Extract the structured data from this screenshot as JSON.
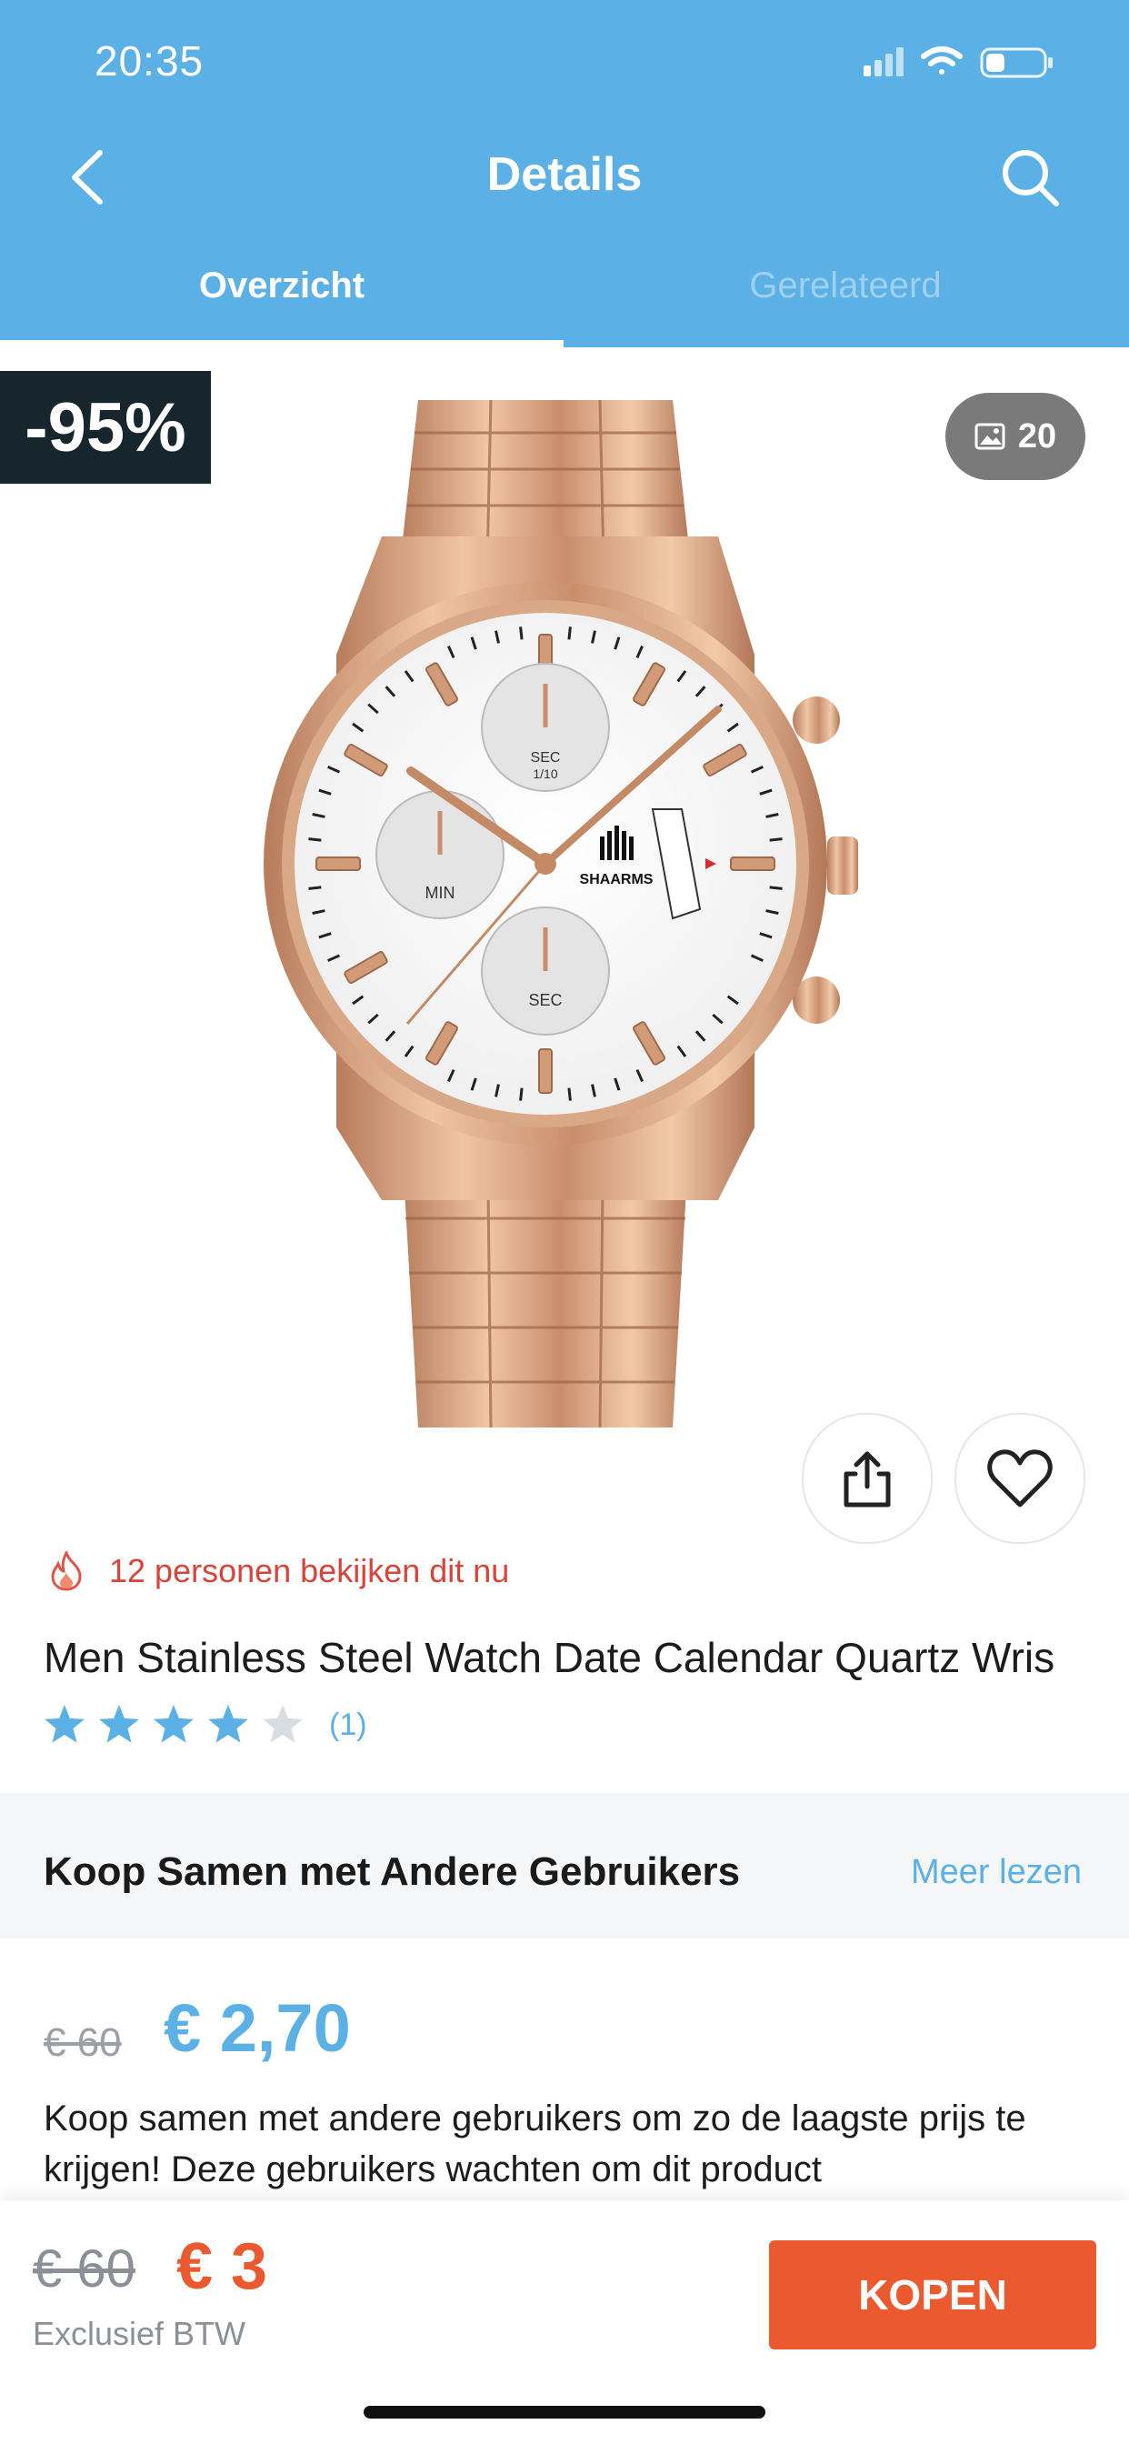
{
  "status_bar": {
    "time": "20:35"
  },
  "header": {
    "title": "Details"
  },
  "tabs": [
    {
      "label": "Overzicht"
    },
    {
      "label": "Gerelateerd"
    }
  ],
  "gallery": {
    "discount_badge": "-95%",
    "image_count": "20"
  },
  "watch_text": {
    "brand": "SHAARMS",
    "sub_top": "SEC",
    "sub_top_2": "1/10",
    "sub_left": "MIN",
    "sub_bottom": "SEC"
  },
  "viewers": {
    "text": "12 personen bekijken dit nu"
  },
  "product": {
    "title": "Men Stainless Steel Watch Date Calendar Quartz Wris",
    "rating": 4,
    "rating_count": "(1)"
  },
  "section": {
    "title": "Koop Samen met Andere Gebruikers",
    "link": "Meer lezen"
  },
  "group_price": {
    "old": "€ 60",
    "new": "€ 2,70"
  },
  "description": "Koop samen met andere gebruikers om zo de laagste prijs te krijgen! Deze gebruikers wachten om dit product",
  "bottom_bar": {
    "old_price": "€ 60",
    "new_price": "€ 3",
    "note": "Exclusief BTW",
    "buy_label": "KOPEN"
  },
  "colors": {
    "accent": "#5BB1E6",
    "buy": "#EA5A2E",
    "alert": "#D8443A"
  }
}
